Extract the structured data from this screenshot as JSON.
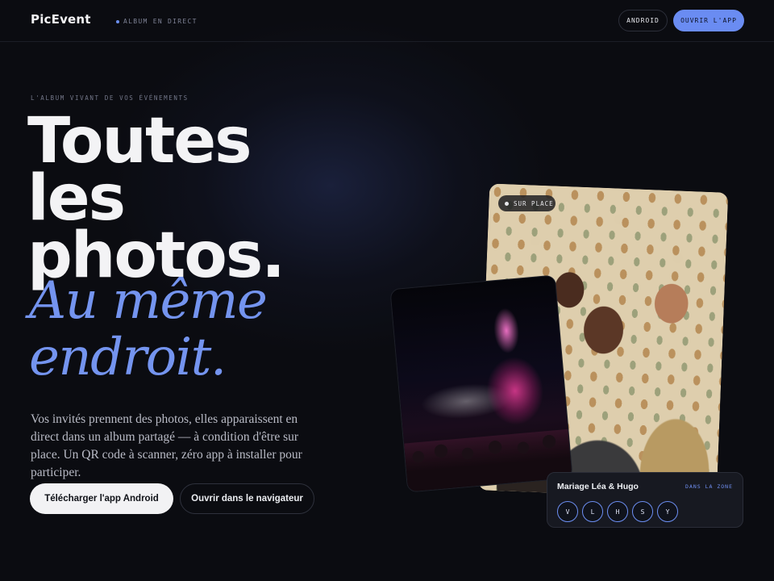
{
  "header": {
    "logo": "PicEvent",
    "tagline": "ALBUM EN DIRECT",
    "android_button": "ANDROID",
    "open_app_button": "OUVRIR L'APP"
  },
  "hero": {
    "eyebrow": "L'ALBUM VIVANT DE VOS ÉVÉNEMENTS",
    "headline_lines": [
      "Toutes",
      "les",
      "photos."
    ],
    "script_lines": [
      "Au même",
      "endroit."
    ],
    "description": "Vos invités prennent des photos, elles apparaissent en direct dans un album partagé — à condition d'être sur place. Un QR code à scanner, zéro app à installer pour participer.",
    "cta_primary": "Télécharger l'app Android",
    "cta_secondary": "Ouvrir dans le navigateur"
  },
  "gallery": {
    "badge": "SUR PLACE",
    "album_card": {
      "title": "Mariage Léa & Hugo",
      "status": "DANS LA ZONE",
      "avatars": [
        "V",
        "L",
        "H",
        "S",
        "Y"
      ]
    }
  },
  "colors": {
    "background": "#0b0c11",
    "accent": "#6a8cf2",
    "script_text": "#7494ef"
  }
}
